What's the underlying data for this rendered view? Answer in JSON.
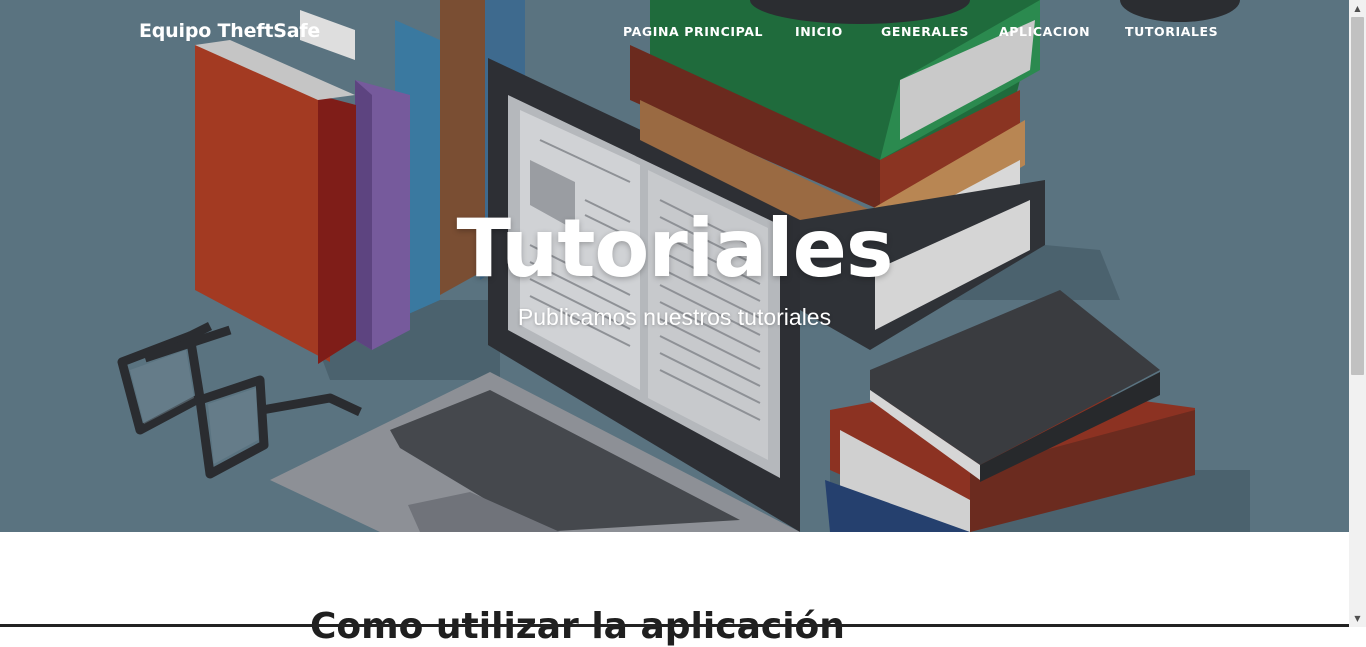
{
  "brand": {
    "name": "Equipo TheftSafe"
  },
  "nav": {
    "items": [
      {
        "label": "PAGINA PRINCIPAL"
      },
      {
        "label": "INICIO"
      },
      {
        "label": "GENERALES"
      },
      {
        "label": "APLICACION"
      },
      {
        "label": "TUTORIALES"
      }
    ]
  },
  "hero": {
    "title": "Tutoriales",
    "subtitle": "Publicamos nuestros tutoriales"
  },
  "section": {
    "heading": "Como utilizar la aplicación"
  },
  "colors": {
    "hero_background": "#5a7380",
    "text": "#ffffff"
  }
}
